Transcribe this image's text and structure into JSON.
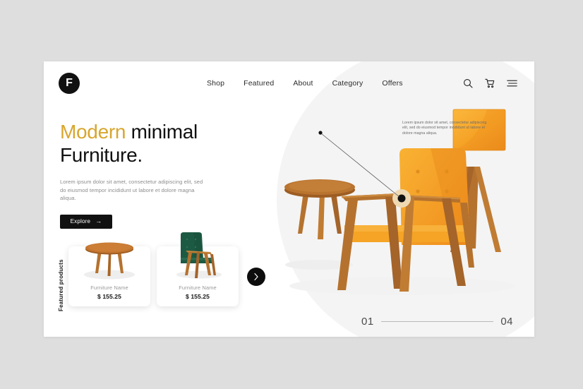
{
  "brand": {
    "logo_letter": "F"
  },
  "nav": {
    "links": [
      {
        "label": "Shop"
      },
      {
        "label": "Featured"
      },
      {
        "label": "About"
      },
      {
        "label": "Category"
      },
      {
        "label": "Offers"
      }
    ],
    "icons": [
      {
        "name": "search-icon"
      },
      {
        "name": "cart-icon"
      },
      {
        "name": "hamburger-menu-icon"
      }
    ]
  },
  "hero": {
    "title_accent": "Modern",
    "title_rest": " minimal Furniture.",
    "paragraph": "Lorem ipsum dolor sit amet, consectetur adipiscing elit, sed do eiusmod tempor incididunt ut labore et dolore magna aliqua.",
    "cta_label": "Explore",
    "cta_arrow": "→",
    "accent_color": "#d8a62f"
  },
  "annotation": {
    "text": "Lorem ipsum dolor sit amet, consectetur adipiscing elit, sed do eiusmod tempor incididunt ut labore et dolore magna aliqua."
  },
  "featured": {
    "label": "Featured products",
    "next_label": "›",
    "products": [
      {
        "name": "Furniture Name",
        "price": "$ 155.25",
        "art": "round-wood-table"
      },
      {
        "name": "Furniture Name",
        "price": "$ 155.25",
        "art": "green-armchair"
      }
    ]
  },
  "pagination": {
    "current": "01",
    "total": "04"
  },
  "colors": {
    "page_background": "#dedede",
    "card_background": "#ffffff",
    "dark": "#111111",
    "accent_gold": "#d8a62f",
    "orange": "#f5a623",
    "wood": "#b5712d",
    "green": "#1f5b44"
  }
}
